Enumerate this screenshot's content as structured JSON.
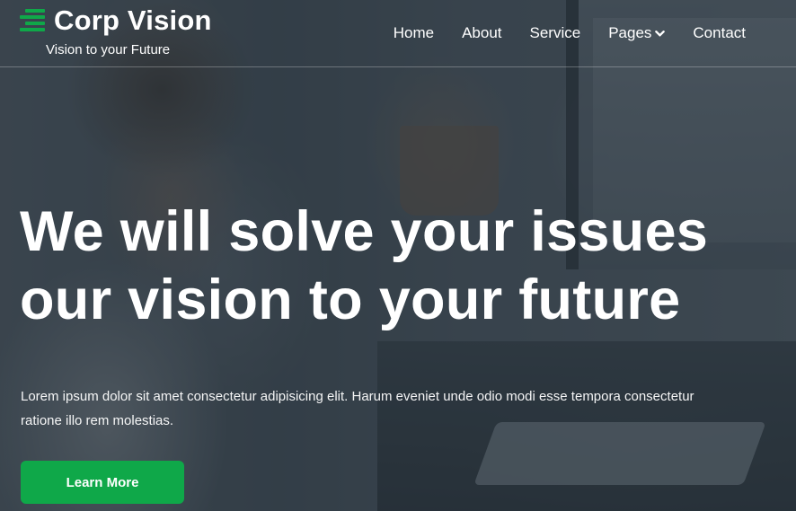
{
  "brand": {
    "title": "Corp Vision",
    "tagline": "Vision to your Future",
    "accent_color": "#0fa849"
  },
  "nav": {
    "items": [
      {
        "label": "Home"
      },
      {
        "label": "About"
      },
      {
        "label": "Service"
      },
      {
        "label": "Pages",
        "icon": "chevron-down-icon"
      },
      {
        "label": "Contact"
      }
    ]
  },
  "hero": {
    "headline_line1": "We will solve your issues",
    "headline_line2": "our vision to your future",
    "description": "Lorem ipsum dolor sit amet consectetur adipisicing elit. Harum eveniet unde odio modi esse tempora consectetur ratione illo rem molestias.",
    "cta_label": "Learn More"
  }
}
